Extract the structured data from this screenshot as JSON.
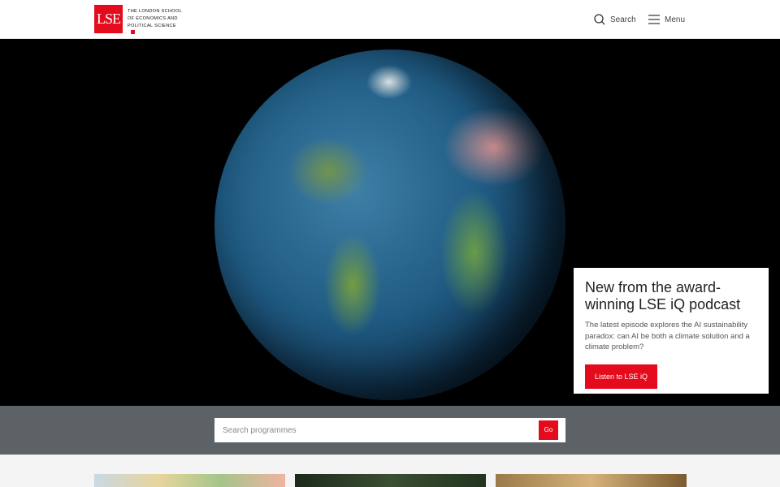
{
  "header": {
    "logo_mark": "LSE",
    "logo_lines": [
      "The London School",
      "of Economics and",
      "Political Science"
    ],
    "search_label": "Search",
    "menu_label": "Menu"
  },
  "hero": {
    "promo": {
      "title": "New from the award-winning LSE iQ podcast",
      "description": "The latest episode explores the AI sustainability paradox: can AI be both a climate solution and a climate problem?",
      "button_label": "Listen to LSE iQ"
    }
  },
  "programme_search": {
    "placeholder": "Search programmes",
    "value": "",
    "go_label": "Go"
  },
  "colors": {
    "brand_red": "#e30b1c",
    "search_band": "#5c6266"
  }
}
